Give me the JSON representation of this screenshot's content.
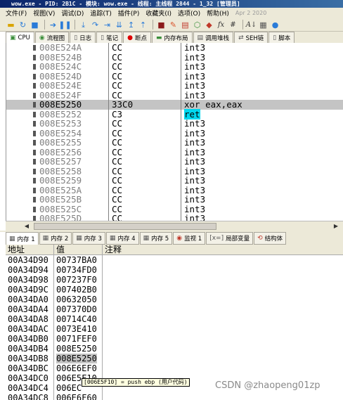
{
  "window": {
    "title": "wow.exe - PID: 2B1C - 模块: wow.exe - 线程: 主线程 2844 - 1_32 [管理员]"
  },
  "menu": {
    "items": [
      "文件(F)",
      "视图(V)",
      "调试(D)",
      "追踪(T)",
      "插件(P)",
      "收藏夹(I)",
      "选项(O)",
      "帮助(H)"
    ],
    "date": "Apr 2 2020"
  },
  "toolbar": {
    "icons": [
      "open-icon",
      "restart-icon",
      "close-icon",
      "run-icon",
      "pause-icon",
      "step-into-icon",
      "step-over-icon",
      "trace-into-icon",
      "trace-over-icon",
      "execute-till-return-icon",
      "run-to-user-code-icon",
      "stop-icon",
      "patch-icon",
      "comment-icon",
      "label-icon",
      "bookmark-icon",
      "function-icon",
      "hash-icon",
      "font-icon",
      "calculator-icon",
      "help-icon"
    ],
    "fx_label": "fx",
    "hash_label": "#",
    "az_label": "A↓"
  },
  "tabs": [
    {
      "icon": "cpu-icon",
      "label": "CPU"
    },
    {
      "icon": "graph-icon",
      "label": "流程图"
    },
    {
      "icon": "log-icon",
      "label": "日志"
    },
    {
      "icon": "notes-icon",
      "label": "笔记"
    },
    {
      "icon": "breakpoint-icon",
      "label": "断点"
    },
    {
      "icon": "memory-map-icon",
      "label": "内存布局"
    },
    {
      "icon": "call-stack-icon",
      "label": "调用堆栈"
    },
    {
      "icon": "seh-icon",
      "label": "SEH链"
    },
    {
      "icon": "script-icon",
      "label": "脚本"
    }
  ],
  "disassembly": {
    "selected_index": 6,
    "rows": [
      {
        "addr": "008E524A",
        "bytes": "CC",
        "instr": "int3"
      },
      {
        "addr": "008E524B",
        "bytes": "CC",
        "instr": "int3"
      },
      {
        "addr": "008E524C",
        "bytes": "CC",
        "instr": "int3"
      },
      {
        "addr": "008E524D",
        "bytes": "CC",
        "instr": "int3"
      },
      {
        "addr": "008E524E",
        "bytes": "CC",
        "instr": "int3"
      },
      {
        "addr": "008E524F",
        "bytes": "CC",
        "instr": "int3"
      },
      {
        "addr": "008E5250",
        "bytes": "33C0",
        "instr": "xor eax,eax"
      },
      {
        "addr": "008E5252",
        "bytes": "C3",
        "instr": "ret"
      },
      {
        "addr": "008E5253",
        "bytes": "CC",
        "instr": "int3"
      },
      {
        "addr": "008E5254",
        "bytes": "CC",
        "instr": "int3"
      },
      {
        "addr": "008E5255",
        "bytes": "CC",
        "instr": "int3"
      },
      {
        "addr": "008E5256",
        "bytes": "CC",
        "instr": "int3"
      },
      {
        "addr": "008E5257",
        "bytes": "CC",
        "instr": "int3"
      },
      {
        "addr": "008E5258",
        "bytes": "CC",
        "instr": "int3"
      },
      {
        "addr": "008E5259",
        "bytes": "CC",
        "instr": "int3"
      },
      {
        "addr": "008E525A",
        "bytes": "CC",
        "instr": "int3"
      },
      {
        "addr": "008E525B",
        "bytes": "CC",
        "instr": "int3"
      },
      {
        "addr": "008E525C",
        "bytes": "CC",
        "instr": "int3"
      },
      {
        "addr": "008E525D",
        "bytes": "CC",
        "instr": "int3"
      }
    ]
  },
  "memory_tabs": [
    {
      "icon": "memory-icon",
      "label": "内存 1"
    },
    {
      "icon": "memory-icon",
      "label": "内存 2"
    },
    {
      "icon": "memory-icon",
      "label": "内存 3"
    },
    {
      "icon": "memory-icon",
      "label": "内存 4"
    },
    {
      "icon": "memory-icon",
      "label": "内存 5"
    },
    {
      "icon": "watch-icon",
      "label": "监视 1"
    },
    {
      "icon": "locals-icon",
      "label": "局部变量"
    },
    {
      "icon": "struct-icon",
      "label": "结构体"
    }
  ],
  "memory": {
    "headers": {
      "address": "地址",
      "value": "值",
      "comment": "注释"
    },
    "selected_index": 10,
    "rows": [
      {
        "addr": "00A34D90",
        "value": "00737BA0"
      },
      {
        "addr": "00A34D94",
        "value": "00734FD0"
      },
      {
        "addr": "00A34D98",
        "value": "007237F0"
      },
      {
        "addr": "00A34D9C",
        "value": "007402B0"
      },
      {
        "addr": "00A34DA0",
        "value": "00632050"
      },
      {
        "addr": "00A34DA4",
        "value": "007370D0"
      },
      {
        "addr": "00A34DA8",
        "value": "00714C40"
      },
      {
        "addr": "00A34DAC",
        "value": "0073E410"
      },
      {
        "addr": "00A34DB0",
        "value": "0071FEF0"
      },
      {
        "addr": "00A34DB4",
        "value": "008E5250"
      },
      {
        "addr": "00A34DB8",
        "value": "008E5250"
      },
      {
        "addr": "00A34DBC",
        "value": "006E6EF0"
      },
      {
        "addr": "00A34DC0",
        "value": "006E5F10"
      },
      {
        "addr": "00A34DC4",
        "value": "006EC"
      },
      {
        "addr": "00A34DC8",
        "value": "006E6F60"
      }
    ]
  },
  "tooltip": "[006E5F10] = push ebp (用户代码)",
  "watermark": "CSDN @zhaopeng01zp",
  "colors": {
    "selection": "#c4c4c4",
    "ret_highlight": "#00d8f0",
    "address_gray": "#808080"
  }
}
